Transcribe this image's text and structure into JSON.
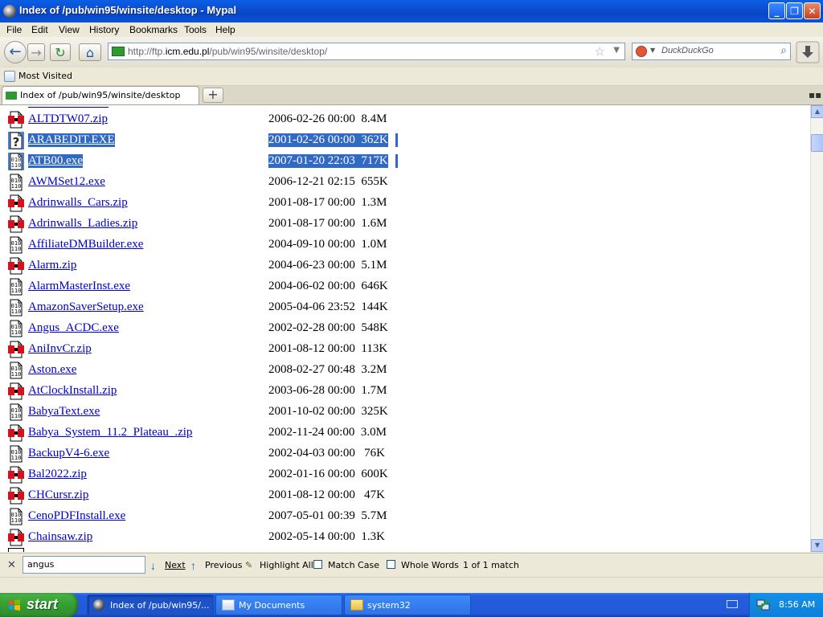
{
  "window": {
    "title": "Index of /pub/win95/winsite/desktop - Mypal"
  },
  "menu": [
    "File",
    "Edit",
    "View",
    "History",
    "Bookmarks",
    "Tools",
    "Help"
  ],
  "nav": {
    "url_domain_prefix": "http://ftp.",
    "url_domain": "icm.edu.pl",
    "url_path": "/pub/win95/winsite/desktop/",
    "search_placeholder": "DuckDuckGo"
  },
  "bookmarks": {
    "most_visited": "Most Visited"
  },
  "tab": {
    "label": "Index of /pub/win95/winsite/desktop",
    "new_tab": "+"
  },
  "files": [
    {
      "name": "ALTDTW07.zip",
      "meta": "2006-02-26 00:00  8.4M",
      "type": "zip",
      "selected": false
    },
    {
      "name": "ARABEDIT.EXE",
      "meta": "2001-02-26 00:00  362K",
      "type": "unknown",
      "selected": true
    },
    {
      "name": "ATB00.exe",
      "meta": "2007-01-20 22:03  717K",
      "type": "exe",
      "selected": true
    },
    {
      "name": "AWMSet12.exe",
      "meta": "2006-12-21 02:15  655K",
      "type": "exe",
      "selected": false
    },
    {
      "name": "Adrinwalls_Cars.zip",
      "meta": "2001-08-17 00:00  1.3M",
      "type": "zip",
      "selected": false
    },
    {
      "name": "Adrinwalls_Ladies.zip",
      "meta": "2001-08-17 00:00  1.6M",
      "type": "zip",
      "selected": false
    },
    {
      "name": "AffiliateDMBuilder.exe",
      "meta": "2004-09-10 00:00  1.0M",
      "type": "exe",
      "selected": false
    },
    {
      "name": "Alarm.zip",
      "meta": "2004-06-23 00:00  5.1M",
      "type": "zip",
      "selected": false
    },
    {
      "name": "AlarmMasterInst.exe",
      "meta": "2004-06-02 00:00  646K",
      "type": "exe",
      "selected": false
    },
    {
      "name": "AmazonSaverSetup.exe",
      "meta": "2005-04-06 23:52  144K",
      "type": "exe",
      "selected": false
    },
    {
      "name": "Angus_ACDC.exe",
      "meta": "2002-02-28 00:00  548K",
      "type": "exe",
      "selected": false
    },
    {
      "name": "AniInvCr.zip",
      "meta": "2001-08-12 00:00  113K",
      "type": "zip",
      "selected": false
    },
    {
      "name": "Aston.exe",
      "meta": "2008-02-27 00:48  3.2M",
      "type": "exe",
      "selected": false
    },
    {
      "name": "AtClockInstall.zip",
      "meta": "2003-06-28 00:00  1.7M",
      "type": "zip",
      "selected": false
    },
    {
      "name": "BabyaText.exe",
      "meta": "2001-10-02 00:00  325K",
      "type": "exe",
      "selected": false
    },
    {
      "name": "Babya_System_11.2_Plateau_.zip",
      "meta": "2002-11-24 00:00  3.0M",
      "type": "zip",
      "selected": false
    },
    {
      "name": "BackupV4-6.exe",
      "meta": "2002-04-03 00:00   76K",
      "type": "exe",
      "selected": false
    },
    {
      "name": "Bal2022.zip",
      "meta": "2002-01-16 00:00  600K",
      "type": "zip",
      "selected": false
    },
    {
      "name": "CHCursr.zip",
      "meta": "2001-08-12 00:00   47K",
      "type": "zip",
      "selected": false
    },
    {
      "name": "CenoPDFInstall.exe",
      "meta": "2007-05-01 00:39  5.7M",
      "type": "exe",
      "selected": false
    },
    {
      "name": "Chainsaw.zip",
      "meta": "2002-05-14 00:00  1.3K",
      "type": "zip",
      "selected": false
    }
  ],
  "findbar": {
    "query": "angus",
    "next": "Next",
    "previous": "Previous",
    "highlight_all": "Highlight All",
    "match_case": "Match Case",
    "whole_words": "Whole Words",
    "result": "1 of 1 match"
  },
  "taskbar": {
    "start": "start",
    "tasks": [
      {
        "label": "Index of /pub/win95/...",
        "active": true
      },
      {
        "label": "My Documents",
        "active": false
      },
      {
        "label": "system32",
        "active": false
      }
    ],
    "clock": "8:56 AM"
  }
}
